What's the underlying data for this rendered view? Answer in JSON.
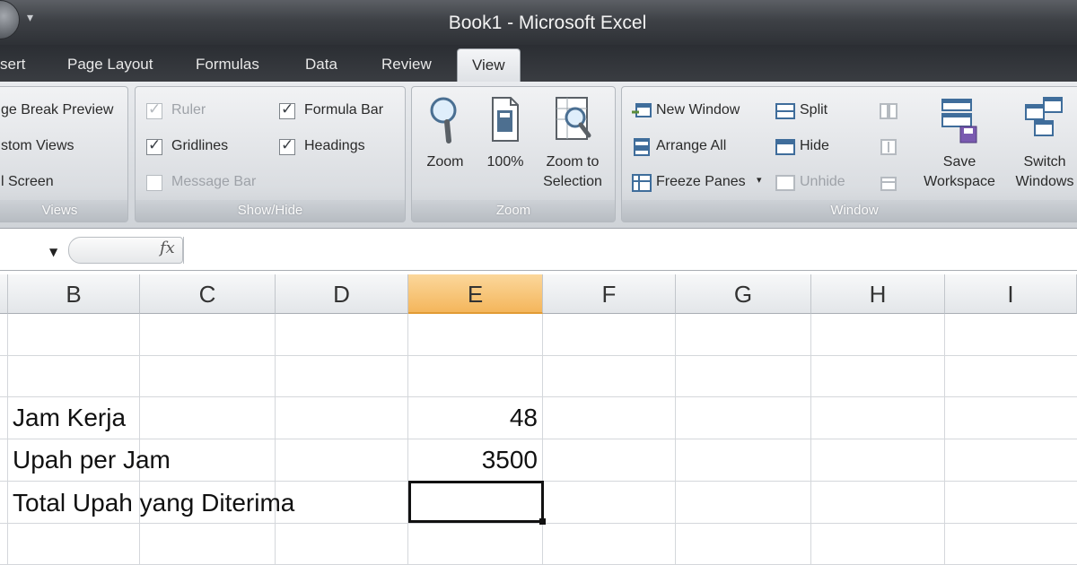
{
  "window": {
    "title": "Book1 - Microsoft Excel"
  },
  "tabs": [
    {
      "label": "sert"
    },
    {
      "label": "Page Layout"
    },
    {
      "label": "Formulas"
    },
    {
      "label": "Data"
    },
    {
      "label": "Review"
    },
    {
      "label": "View",
      "active": true
    }
  ],
  "ribbon": {
    "views": {
      "label": "Views",
      "items": [
        "ge Break Preview",
        "stom Views",
        "l Screen"
      ]
    },
    "show_hide": {
      "label": "Show/Hide",
      "ruler": {
        "label": "Ruler",
        "checked": true,
        "enabled": false
      },
      "gridlines": {
        "label": "Gridlines",
        "checked": true
      },
      "message_bar": {
        "label": "Message Bar",
        "checked": false,
        "enabled": false
      },
      "formula_bar": {
        "label": "Formula Bar",
        "checked": true
      },
      "headings": {
        "label": "Headings",
        "checked": true
      }
    },
    "zoom": {
      "label": "Zoom",
      "zoom_btn": "Zoom",
      "hundred_btn": "100%",
      "zoom_sel_line1": "Zoom to",
      "zoom_sel_line2": "Selection"
    },
    "window": {
      "label": "Window",
      "new_window": "New Window",
      "arrange_all": "Arrange All",
      "freeze_panes": "Freeze Panes",
      "split": "Split",
      "hide": "Hide",
      "unhide": "Unhide",
      "save_ws_line1": "Save",
      "save_ws_line2": "Workspace",
      "switch_line1": "Switch",
      "switch_line2": "Windows"
    }
  },
  "formula_bar": {
    "fx": "fx",
    "content": ""
  },
  "grid": {
    "columns": [
      "B",
      "C",
      "D",
      "E",
      "F",
      "G",
      "H",
      "I"
    ],
    "selected_column": "E",
    "cells": {
      "b_jam_kerja": "Jam Kerja",
      "e_jam_kerja": "48",
      "b_upah": "Upah per Jam",
      "e_upah": "3500",
      "b_total": "Total Upah yang Diterima",
      "e_total": ""
    }
  },
  "colors": {
    "selected_header": "#f4b65c",
    "ribbon_bg": "#dadde1",
    "titlebar": "#3e4146"
  }
}
